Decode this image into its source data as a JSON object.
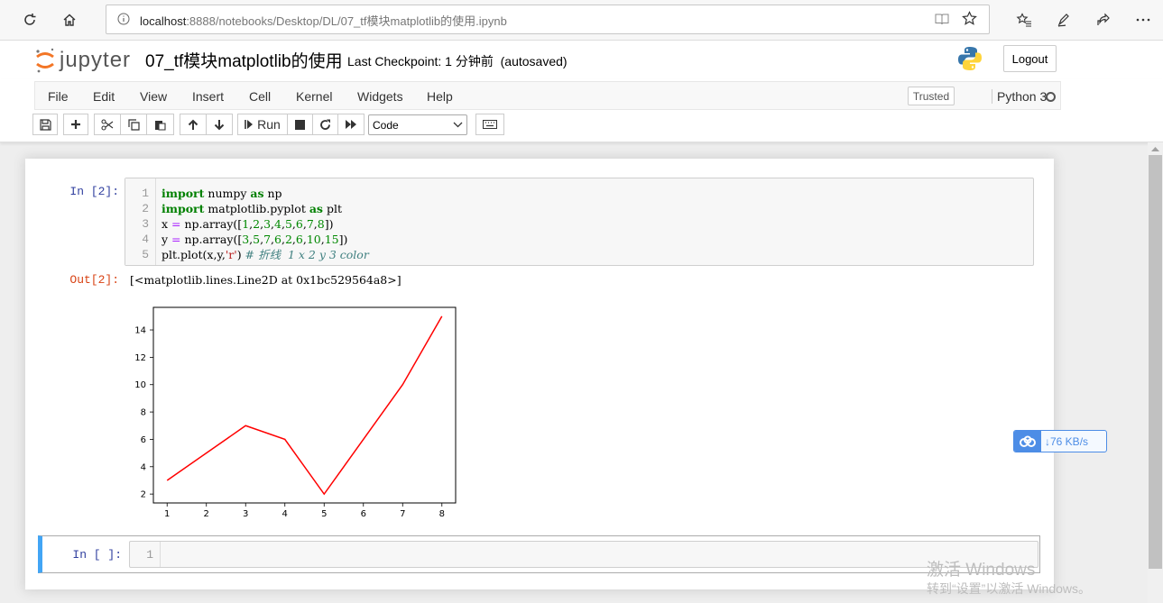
{
  "browser": {
    "url_host": "localhost",
    "url_path": ":8888/notebooks/Desktop/DL/07_tf模块matplotlib的使用.ipynb"
  },
  "header": {
    "logo_text": "jupyter",
    "notebook_title": "07_tf模块matplotlib的使用",
    "checkpoint": "Last Checkpoint: 1 分钟前",
    "autosaved": "(autosaved)",
    "logout_label": "Logout"
  },
  "menu": {
    "items": [
      "File",
      "Edit",
      "View",
      "Insert",
      "Cell",
      "Kernel",
      "Widgets",
      "Help"
    ],
    "trusted": "Trusted",
    "kernel": "Python 3"
  },
  "toolbar": {
    "run_label": "Run",
    "cell_type": "Code"
  },
  "cells": {
    "in_prompt": "In [2]:",
    "out_prompt": "Out[2]:",
    "line_numbers": [
      "1",
      "2",
      "3",
      "4",
      "5"
    ],
    "output_text": "[<matplotlib.lines.Line2D at 0x1bc529564a8>]",
    "empty_prompt": "In [ ]:",
    "empty_line_number": "1"
  },
  "chart_data": {
    "type": "line",
    "x": [
      1,
      2,
      3,
      4,
      5,
      6,
      7,
      8
    ],
    "series": [
      {
        "values": [
          3,
          5,
          7,
          6,
          2,
          6,
          10,
          15
        ],
        "color": "#ff0000"
      }
    ],
    "xticks": [
      "1",
      "2",
      "3",
      "4",
      "5",
      "6",
      "7",
      "8"
    ],
    "yticks": [
      "2",
      "4",
      "6",
      "8",
      "10",
      "12",
      "14"
    ],
    "xlim": [
      0.65,
      8.35
    ],
    "ylim": [
      1.35,
      15.65
    ],
    "grid": false
  },
  "speed_widget": {
    "text": "↓76 KB/s"
  },
  "watermark": {
    "line1": "激活 Windows",
    "line2": "转到“设置”以激活 Windows。"
  }
}
